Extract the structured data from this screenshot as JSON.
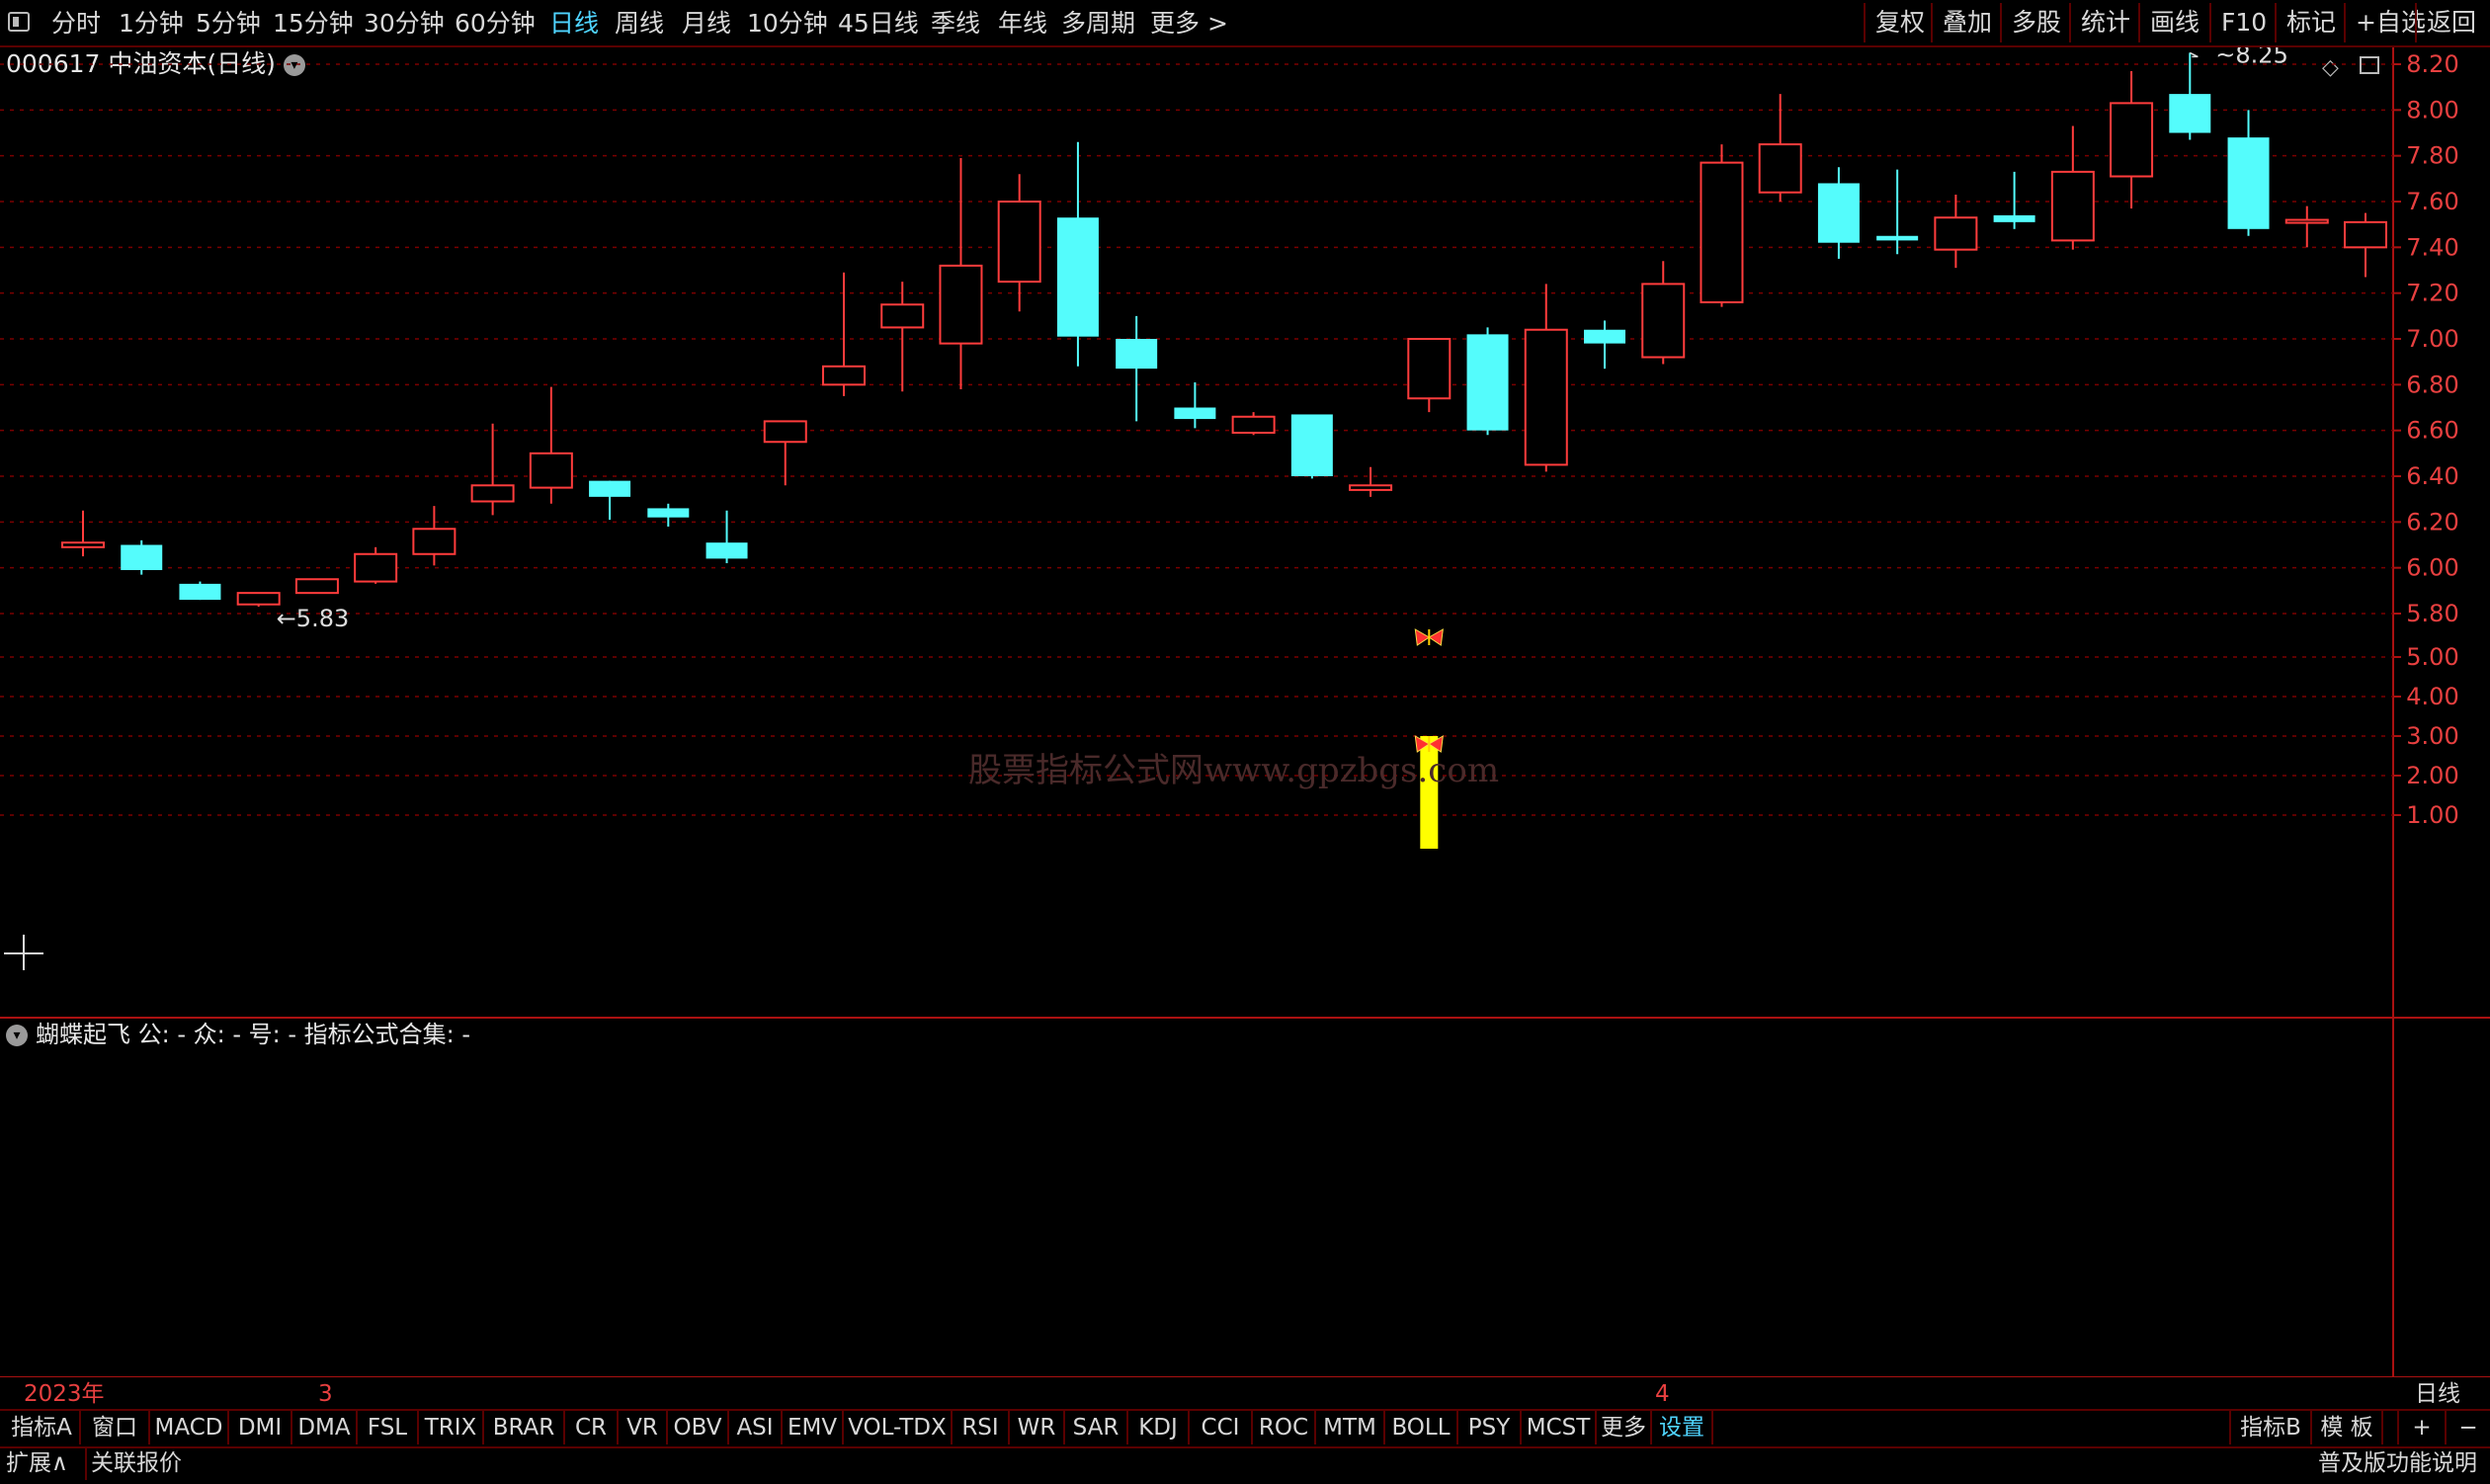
{
  "toolbar": {
    "periods": [
      "分时",
      "1分钟",
      "5分钟",
      "15分钟",
      "30分钟",
      "60分钟",
      "日线",
      "周线",
      "月线",
      "10分钟",
      "45日线",
      "季线",
      "年线",
      "多周期",
      "更多 >"
    ],
    "active_period": "日线",
    "right_buttons": [
      "复权",
      "叠加",
      "多股",
      "统计",
      "画线",
      "F10",
      "标记",
      "+自选",
      "返回"
    ]
  },
  "stock": {
    "title": "000617 中油资本(日线)"
  },
  "watermark": "股票指标公式网www.gpzbgs.com",
  "price_axis": {
    "ticks": [
      "8.20",
      "8.00",
      "7.80",
      "7.60",
      "7.40",
      "7.20",
      "7.00",
      "6.80",
      "6.60",
      "6.40",
      "6.20",
      "6.00",
      "5.80"
    ]
  },
  "annotations": {
    "high": "8.25",
    "low": "5.83"
  },
  "indicator": {
    "title": "蝴蝶起飞  公: -  众: -  号: -  指标公式合集: -",
    "ticks": [
      "5.00",
      "4.00",
      "3.00",
      "2.00",
      "1.00"
    ]
  },
  "dates": {
    "year": "2023年",
    "m3": "3",
    "m4": "4",
    "period_label": "日线"
  },
  "tabs": [
    "指标A",
    "窗口",
    "MACD",
    "DMI",
    "DMA",
    "FSL",
    "TRIX",
    "BRAR",
    "CR",
    "VR",
    "OBV",
    "ASI",
    "EMV",
    "VOL-TDX",
    "RSI",
    "WR",
    "SAR",
    "KDJ",
    "CCI",
    "ROC",
    "MTM",
    "BOLL",
    "PSY",
    "MCST",
    "更多",
    "设置"
  ],
  "active_tab": "设置",
  "tabs_right": [
    "指标B",
    "模 板",
    "+",
    "−"
  ],
  "status": {
    "expand": "扩展∧",
    "linked": "关联报价",
    "edition": "普及版功能说明"
  },
  "colors": {
    "up": "#ff3c3c",
    "down": "#54fcfc",
    "grid": "#7a0000",
    "axis_text": "#e84040",
    "signal": "#ffff00"
  },
  "chart_data": {
    "type": "candlestick",
    "ylim": [
      5.75,
      8.3
    ],
    "candles": [
      {
        "o": 6.09,
        "c": 6.11,
        "h": 6.25,
        "l": 6.05
      },
      {
        "o": 6.1,
        "c": 5.99,
        "h": 6.12,
        "l": 5.97
      },
      {
        "o": 5.93,
        "c": 5.86,
        "h": 5.94,
        "l": 5.86
      },
      {
        "o": 5.84,
        "c": 5.89,
        "h": 5.89,
        "l": 5.83
      },
      {
        "o": 5.89,
        "c": 5.95,
        "h": 5.95,
        "l": 5.89
      },
      {
        "o": 5.94,
        "c": 6.06,
        "h": 6.09,
        "l": 5.93
      },
      {
        "o": 6.06,
        "c": 6.17,
        "h": 6.27,
        "l": 6.01
      },
      {
        "o": 6.29,
        "c": 6.36,
        "h": 6.63,
        "l": 6.23
      },
      {
        "o": 6.35,
        "c": 6.5,
        "h": 6.79,
        "l": 6.28
      },
      {
        "o": 6.38,
        "c": 6.31,
        "h": 6.38,
        "l": 6.21
      },
      {
        "o": 6.26,
        "c": 6.22,
        "h": 6.28,
        "l": 6.18
      },
      {
        "o": 6.11,
        "c": 6.04,
        "h": 6.25,
        "l": 6.02
      },
      {
        "o": 6.55,
        "c": 6.64,
        "h": 6.64,
        "l": 6.36
      },
      {
        "o": 6.8,
        "c": 6.88,
        "h": 7.29,
        "l": 6.75
      },
      {
        "o": 7.05,
        "c": 7.15,
        "h": 7.25,
        "l": 6.77
      },
      {
        "o": 6.98,
        "c": 7.32,
        "h": 7.79,
        "l": 6.78
      },
      {
        "o": 7.25,
        "c": 7.6,
        "h": 7.72,
        "l": 7.12
      },
      {
        "o": 7.53,
        "c": 7.01,
        "h": 7.86,
        "l": 6.88
      },
      {
        "o": 7.0,
        "c": 6.87,
        "h": 7.1,
        "l": 6.64
      },
      {
        "o": 6.7,
        "c": 6.65,
        "h": 6.81,
        "l": 6.61
      },
      {
        "o": 6.59,
        "c": 6.66,
        "h": 6.68,
        "l": 6.58
      },
      {
        "o": 6.67,
        "c": 6.4,
        "h": 6.67,
        "l": 6.39
      },
      {
        "o": 6.34,
        "c": 6.36,
        "h": 6.44,
        "l": 6.31
      },
      {
        "o": 6.74,
        "c": 7.0,
        "h": 7.0,
        "l": 6.68
      },
      {
        "o": 7.02,
        "c": 6.6,
        "h": 7.05,
        "l": 6.58
      },
      {
        "o": 6.45,
        "c": 7.04,
        "h": 7.24,
        "l": 6.42
      },
      {
        "o": 7.04,
        "c": 6.98,
        "h": 7.08,
        "l": 6.87
      },
      {
        "o": 6.92,
        "c": 7.24,
        "h": 7.34,
        "l": 6.89
      },
      {
        "o": 7.16,
        "c": 7.77,
        "h": 7.85,
        "l": 7.14
      },
      {
        "o": 7.64,
        "c": 7.85,
        "h": 8.07,
        "l": 7.6
      },
      {
        "o": 7.68,
        "c": 7.42,
        "h": 7.75,
        "l": 7.35
      },
      {
        "o": 7.45,
        "c": 7.43,
        "h": 7.74,
        "l": 7.37
      },
      {
        "o": 7.39,
        "c": 7.53,
        "h": 7.63,
        "l": 7.31
      },
      {
        "o": 7.54,
        "c": 7.51,
        "h": 7.73,
        "l": 7.48
      },
      {
        "o": 7.43,
        "c": 7.73,
        "h": 7.93,
        "l": 7.39
      },
      {
        "o": 7.71,
        "c": 8.03,
        "h": 8.17,
        "l": 7.57
      },
      {
        "o": 8.07,
        "c": 7.9,
        "h": 8.25,
        "l": 7.87
      },
      {
        "o": 7.88,
        "c": 7.48,
        "h": 8.0,
        "l": 7.45
      },
      {
        "o": 7.51,
        "c": 7.52,
        "h": 7.58,
        "l": 7.4
      },
      {
        "o": 7.4,
        "c": 7.51,
        "h": 7.55,
        "l": 7.27
      }
    ],
    "indicator_ylim": [
      0,
      6
    ],
    "signal": {
      "index": 23,
      "value": 3.0,
      "marker_values": [
        5.5,
        2.8
      ]
    }
  }
}
